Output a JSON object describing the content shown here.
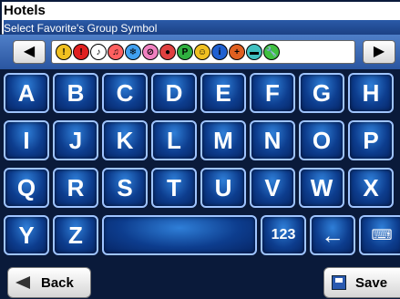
{
  "header": {
    "name_value": "Hotels",
    "prompt": "Select Favorite's Group Symbol"
  },
  "symbol_picker": {
    "prev_glyph": "◀",
    "next_glyph": "▶",
    "symbols": [
      {
        "icon": "circle-i-yellow-icon",
        "glyph": "!",
        "color": "#f0c020"
      },
      {
        "icon": "circle-exclaim-red-icon",
        "glyph": "!",
        "color": "#e02020"
      },
      {
        "icon": "music-icon",
        "glyph": "♪",
        "color": "#ffffff"
      },
      {
        "icon": "music-selected-icon",
        "glyph": "♫",
        "color": "#ff6060"
      },
      {
        "icon": "snowflake-icon",
        "glyph": "❄",
        "color": "#40a0f0"
      },
      {
        "icon": "no-entry-icon",
        "glyph": "⊘",
        "color": "#f080c0"
      },
      {
        "icon": "food-icon",
        "glyph": "●",
        "color": "#e04040"
      },
      {
        "icon": "parking-icon",
        "glyph": "P",
        "color": "#30b040"
      },
      {
        "icon": "face-icon",
        "glyph": "☺",
        "color": "#f0c020"
      },
      {
        "icon": "info-icon",
        "glyph": "i",
        "color": "#2060d0"
      },
      {
        "icon": "hospital-icon",
        "glyph": "+",
        "color": "#e06020"
      },
      {
        "icon": "car-icon",
        "glyph": "▬",
        "color": "#40c0c0"
      },
      {
        "icon": "wrench-icon",
        "glyph": "🔧",
        "color": "#40c040"
      }
    ]
  },
  "keyboard": {
    "rows": [
      [
        "A",
        "B",
        "C",
        "D",
        "E",
        "F",
        "G",
        "H"
      ],
      [
        "I",
        "J",
        "K",
        "L",
        "M",
        "N",
        "O",
        "P"
      ],
      [
        "Q",
        "R",
        "S",
        "T",
        "U",
        "V",
        "W",
        "X"
      ]
    ],
    "last_row": {
      "y": "Y",
      "z": "Z",
      "space": "",
      "numbers": "123",
      "backspace": "←",
      "keyboard_toggle": "⌨"
    }
  },
  "footer": {
    "back_label": "Back",
    "save_label": "Save"
  }
}
